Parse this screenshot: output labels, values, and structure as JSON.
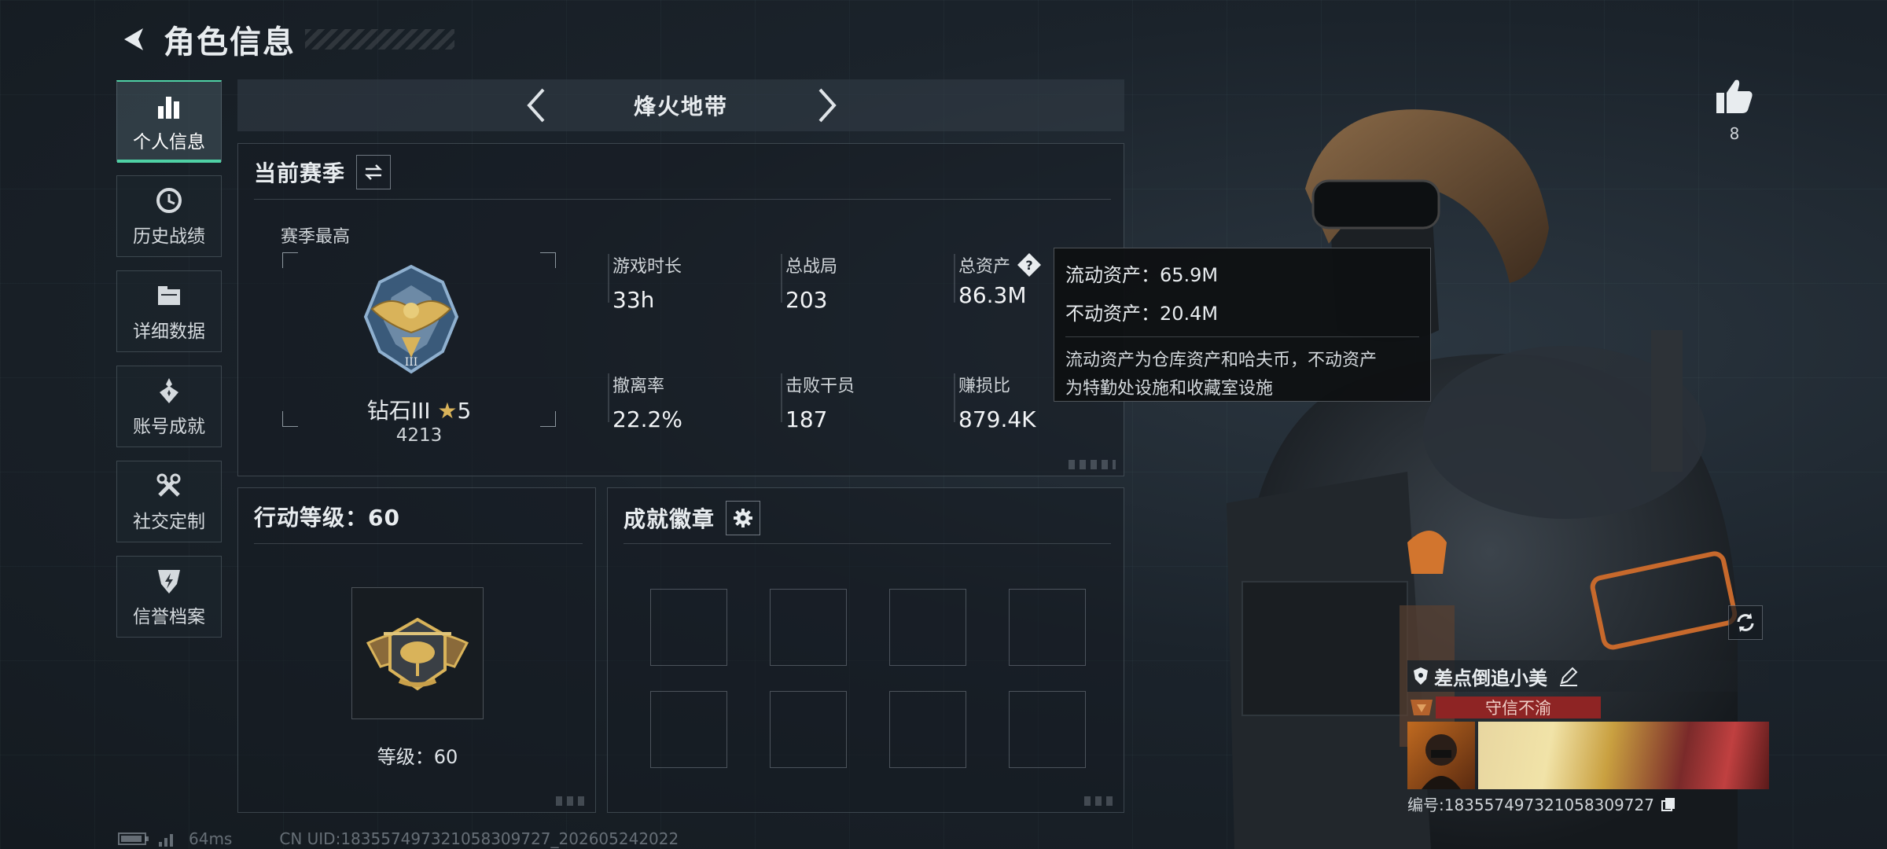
{
  "header": {
    "title": "角色信息"
  },
  "sidenav": {
    "items": [
      {
        "label": "个人信息",
        "icon": "bar-chart-icon",
        "active": true
      },
      {
        "label": "历史战绩",
        "icon": "history-icon"
      },
      {
        "label": "详细数据",
        "icon": "folder-icon"
      },
      {
        "label": "账号成就",
        "icon": "achievement-icon"
      },
      {
        "label": "社交定制",
        "icon": "tools-icon"
      },
      {
        "label": "信誉档案",
        "icon": "shield-bolt-icon"
      }
    ]
  },
  "mode": {
    "title": "烽火地带"
  },
  "season": {
    "title": "当前赛季",
    "best_label": "赛季最高",
    "rank": "钻石III",
    "stars": "5",
    "score": "4213",
    "stats": [
      {
        "label": "游戏时长",
        "value": "33h"
      },
      {
        "label": "总战局",
        "value": "203"
      },
      {
        "label": "总资产",
        "value": "86.3M"
      },
      {
        "label": "撤离率",
        "value": "22.2%"
      },
      {
        "label": "击败干员",
        "value": "187"
      },
      {
        "label": "赚损比",
        "value": "879.4K"
      }
    ]
  },
  "tooltip": {
    "liquid": "流动资产：65.9M",
    "fixed": "不动资产：20.4M",
    "desc_line1": "流动资产为仓库资产和哈夫币，不动资产",
    "desc_line2": "为特勤处设施和收藏室设施"
  },
  "action_level": {
    "title": "行动等级：60",
    "level_text": "等级：60"
  },
  "achievements": {
    "title": "成就徽章"
  },
  "likes": {
    "count": "8"
  },
  "character": {
    "name": "差点倒追小美",
    "title_tag": "守信不渝",
    "id_text": "编号:1835574973210583097​27"
  },
  "footer": {
    "ping": "64ms",
    "uid": "CN UID:1835574973210583097​27_202605242022"
  },
  "colors": {
    "accent": "#4fd1a5",
    "title_tag_bg": "#8e2424",
    "gold": "#d9b35a"
  }
}
